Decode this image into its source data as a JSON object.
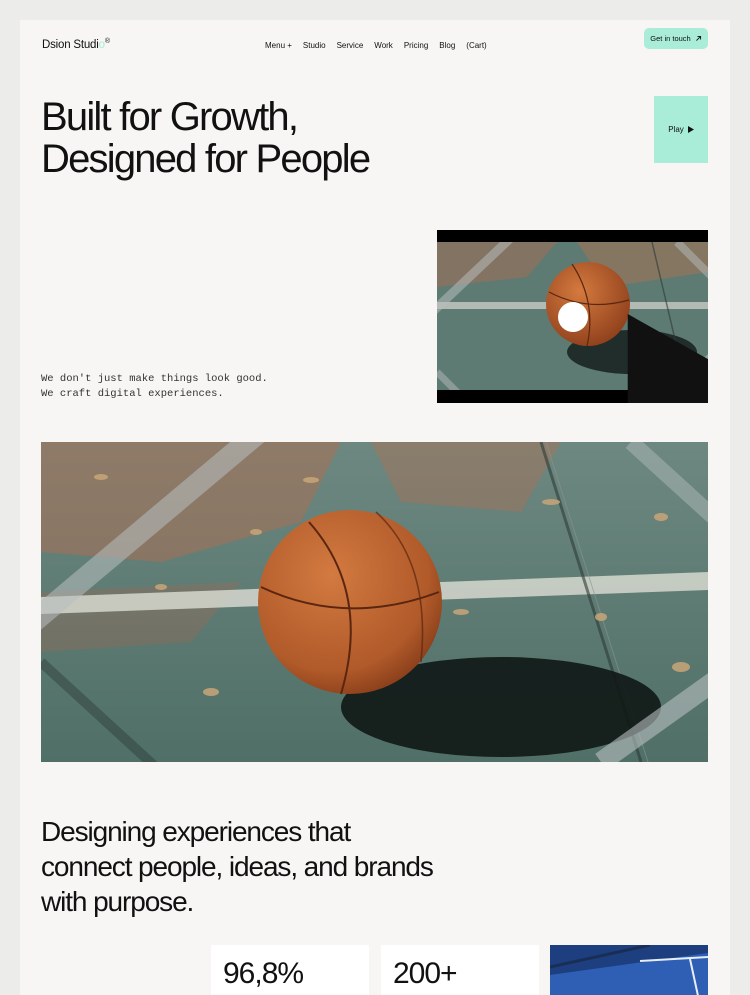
{
  "brand": {
    "name_a": "Dsion Studi",
    "name_b": "o",
    "mark": "®"
  },
  "nav": [
    "Menu +",
    "Studio",
    "Service",
    "Work",
    "Pricing",
    "Blog",
    "(Cart)"
  ],
  "cta": {
    "label": "Get in touch",
    "icon": "arrow-up-right-icon"
  },
  "hero": {
    "title_line1": "Built for Growth,",
    "title_line2": "Designed for People",
    "play_label": "Play",
    "tagline_line1": "We don't just make things look good.",
    "tagline_line2": "We craft digital experiences."
  },
  "about": {
    "line1": "Designing experiences that",
    "line2": "connect people, ideas, and brands",
    "line3": "with purpose."
  },
  "stats": [
    {
      "value": "96,8%"
    },
    {
      "value": "200+"
    }
  ],
  "colors": {
    "accent": "#a9ecd8",
    "page": "#f7f6f4",
    "ball": "#c0622f",
    "court": "#5e7d74"
  }
}
